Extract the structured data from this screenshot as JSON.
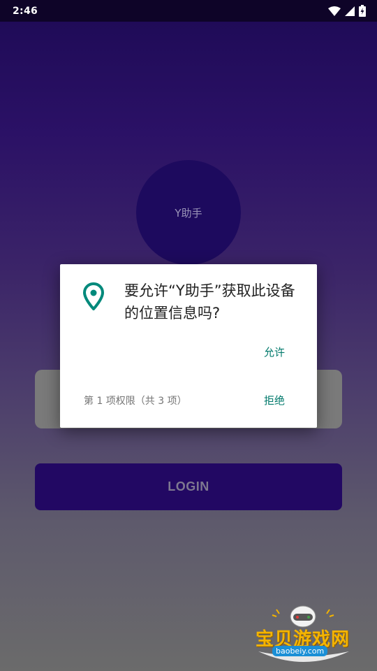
{
  "status_bar": {
    "time": "2:46"
  },
  "app": {
    "avatar_text": "Y助手",
    "login_label": "LOGIN"
  },
  "dialog": {
    "icon": "location-pin-icon",
    "title": "要允许“Y助手”获取此设备的位置信息吗?",
    "allow_label": "允许",
    "deny_label": "拒绝",
    "counter": "第 1 项权限（共 3 项）"
  },
  "watermark": {
    "text": "宝贝游戏网",
    "url": "baobeiy.com"
  },
  "colors": {
    "accent": "#00796b",
    "primary_dark": "#220863"
  }
}
